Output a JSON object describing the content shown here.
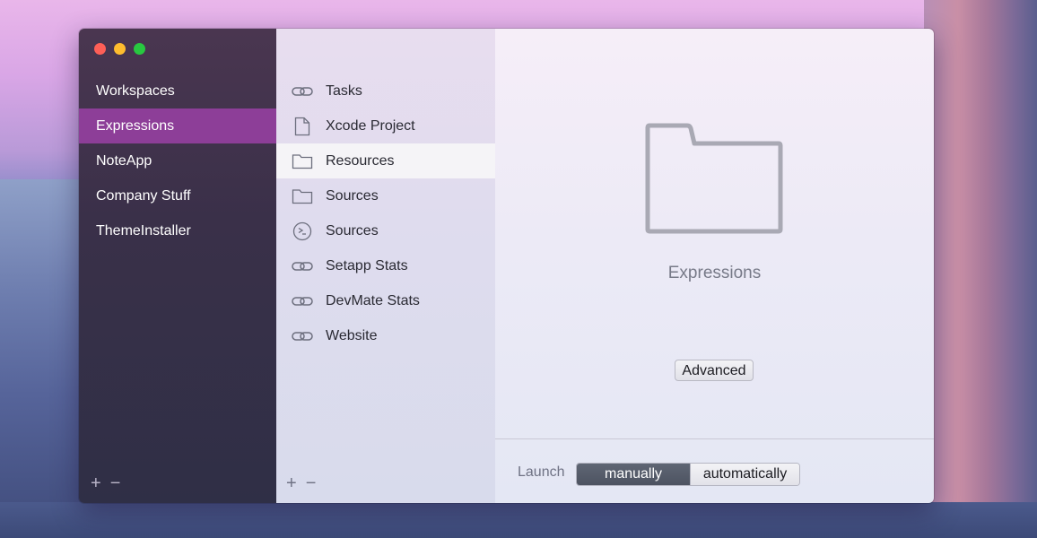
{
  "sidebar": {
    "workspaces": [
      {
        "label": "Workspaces",
        "selected": false
      },
      {
        "label": "Expressions",
        "selected": true
      },
      {
        "label": "NoteApp",
        "selected": false
      },
      {
        "label": "Company Stuff",
        "selected": false
      },
      {
        "label": "ThemeInstaller",
        "selected": false
      }
    ],
    "add_symbol": "+",
    "remove_symbol": "−"
  },
  "middle": {
    "items": [
      {
        "label": "Tasks",
        "icon": "link-icon"
      },
      {
        "label": "Xcode Project",
        "icon": "document-icon"
      },
      {
        "label": "Resources",
        "icon": "folder-icon",
        "selected": true
      },
      {
        "label": "Sources",
        "icon": "folder-icon"
      },
      {
        "label": "Sources",
        "icon": "terminal-icon"
      },
      {
        "label": "Setapp Stats",
        "icon": "link-icon"
      },
      {
        "label": "DevMate Stats",
        "icon": "link-icon"
      },
      {
        "label": "Website",
        "icon": "link-icon"
      }
    ],
    "add_symbol": "+",
    "remove_symbol": "−"
  },
  "detail": {
    "icon": "folder-icon",
    "title": "Expressions",
    "advanced_label": "Advanced",
    "launch_label": "Launch",
    "launch_options": [
      "manually",
      "automatically"
    ],
    "launch_selected": "manually"
  },
  "colors": {
    "selected_workspace": "#8d3e98",
    "active_segment": "#565c6a"
  }
}
